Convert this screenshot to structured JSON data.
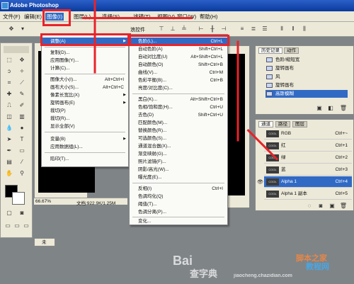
{
  "window": {
    "title": "Adobe Photoshop"
  },
  "menubar": {
    "items": [
      "文件(F)",
      "编辑(E)",
      "图像(I)",
      "图层(L)",
      "选择(S)",
      "滤镜(T)",
      "视图(V)",
      "窗口(W)",
      "帮助(H)"
    ]
  },
  "image_menu": {
    "items": [
      {
        "label": "调整(A)",
        "shortcut": "",
        "submenu": true,
        "highlighted": true
      },
      {
        "label": "复制(D)...",
        "shortcut": ""
      },
      {
        "label": "应用图像(Y)...",
        "shortcut": ""
      },
      {
        "label": "计算(C)...",
        "shortcut": ""
      },
      {
        "label": "图像大小(I)...",
        "shortcut": "Alt+Ctrl+I"
      },
      {
        "label": "画布大小(S)...",
        "shortcut": "Alt+Ctrl+C"
      },
      {
        "label": "像素长宽比(X)",
        "shortcut": "",
        "submenu": true
      },
      {
        "label": "旋转画布(E)",
        "shortcut": "",
        "submenu": true
      },
      {
        "label": "裁切(P)",
        "shortcut": ""
      },
      {
        "label": "裁切(R)...",
        "shortcut": ""
      },
      {
        "label": "显示全部(V)",
        "shortcut": ""
      },
      {
        "label": "变量(B)",
        "shortcut": "",
        "submenu": true
      },
      {
        "label": "应用数据组(L)...",
        "shortcut": ""
      },
      {
        "label": "陷印(T)...",
        "shortcut": ""
      }
    ]
  },
  "adjust_menu": {
    "items": [
      {
        "label": "色阶(L)...",
        "shortcut": "Ctrl+L",
        "highlighted": true
      },
      {
        "label": "自动色阶(A)",
        "shortcut": "Shift+Ctrl+L"
      },
      {
        "label": "自动对比度(U)",
        "shortcut": "Alt+Shift+Ctrl+L"
      },
      {
        "label": "自动颜色(O)",
        "shortcut": "Shift+Ctrl+B"
      },
      {
        "label": "曲线(V)...",
        "shortcut": "Ctrl+M"
      },
      {
        "label": "色彩平衡(B)...",
        "shortcut": "Ctrl+B"
      },
      {
        "label": "亮度/对比度(C)...",
        "shortcut": ""
      },
      {
        "label": "黑白(K)...",
        "shortcut": "Alt+Shift+Ctrl+B"
      },
      {
        "label": "色相/饱和度(H)...",
        "shortcut": "Ctrl+U"
      },
      {
        "label": "去色(D)",
        "shortcut": "Shift+Ctrl+U"
      },
      {
        "label": "匹配颜色(M)...",
        "shortcut": ""
      },
      {
        "label": "替换颜色(R)...",
        "shortcut": ""
      },
      {
        "label": "可选颜色(S)...",
        "shortcut": ""
      },
      {
        "label": "通道混合器(X)...",
        "shortcut": ""
      },
      {
        "label": "渐变映射(G)...",
        "shortcut": ""
      },
      {
        "label": "照片滤镜(F)...",
        "shortcut": ""
      },
      {
        "label": "阴影/高光(W)...",
        "shortcut": ""
      },
      {
        "label": "曝光度(E)...",
        "shortcut": ""
      },
      {
        "label": "反相(I)",
        "shortcut": "Ctrl+I"
      },
      {
        "label": "色调均化(Q)",
        "shortcut": ""
      },
      {
        "label": "阈值(T)...",
        "shortcut": ""
      },
      {
        "label": "色调分离(P)...",
        "shortcut": ""
      },
      {
        "label": "变化...",
        "shortcut": ""
      }
    ]
  },
  "options_bar": {
    "label": "浪控件"
  },
  "doc": {
    "zoom": "66.67%",
    "status": "文档:922.9K/1.25M"
  },
  "history_panel": {
    "tab": "历史记录",
    "tab2": "动作",
    "items": [
      {
        "label": "色阶/缩短宽",
        "selected": false
      },
      {
        "label": "旋转画布",
        "selected": false
      },
      {
        "label": "风",
        "selected": false
      },
      {
        "label": "旋转画布",
        "selected": false
      },
      {
        "label": "高斯模糊",
        "selected": true
      }
    ]
  },
  "channels_panel": {
    "tabs": [
      "通道",
      "路径",
      "图层"
    ],
    "items": [
      {
        "label": "RGB",
        "shortcut": "Ctrl+~",
        "selected": false,
        "visible": false
      },
      {
        "label": "红",
        "shortcut": "Ctrl+1",
        "selected": false,
        "visible": false
      },
      {
        "label": "绿",
        "shortcut": "Ctrl+2",
        "selected": false,
        "visible": false
      },
      {
        "label": "蓝",
        "shortcut": "Ctrl+3",
        "selected": false,
        "visible": false
      },
      {
        "label": "Alpha 1",
        "shortcut": "Ctrl+4",
        "selected": true,
        "visible": true
      },
      {
        "label": "Alpha 1 副本",
        "shortcut": "Ctrl+5",
        "selected": false,
        "visible": false
      }
    ],
    "thumb_text": "COOL"
  },
  "bottom_tab": {
    "label": "未"
  },
  "watermarks": {
    "baidu": "Bai",
    "site": "jiaocheng.chazidian.com",
    "logo1": "脚本之家",
    "logo2": "教程网",
    "query": "查字典"
  },
  "colors": {
    "accent": "#316ac5",
    "annotation_red": "#e8232a"
  }
}
